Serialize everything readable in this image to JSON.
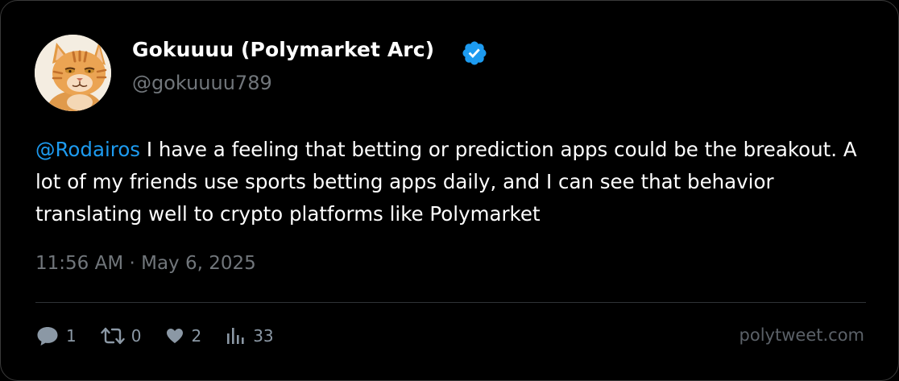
{
  "author": {
    "display_name": "Gokuuuu (Polymarket Arc)",
    "handle": "@gokuuuu789",
    "verified": true,
    "verified_badge_color": "#1d9bf0"
  },
  "tweet": {
    "mention": "@Rodairos",
    "body": " I have a feeling that betting or prediction apps could be the breakout. A lot of my friends use sports betting apps daily, and I can see that behavior translating well to crypto platforms like Polymarket",
    "timestamp": "11:56 AM · May 6, 2025"
  },
  "stats": {
    "replies": "1",
    "retweets": "0",
    "likes": "2",
    "views": "33"
  },
  "icons": {
    "reply": "reply-icon",
    "retweet": "retweet-icon",
    "like": "heart-icon",
    "views": "views-icon",
    "verified": "verified-badge-icon"
  },
  "watermark": "polytweet.com",
  "colors": {
    "background": "#000000",
    "mention": "#1d9bf0",
    "muted": "#71767b"
  }
}
